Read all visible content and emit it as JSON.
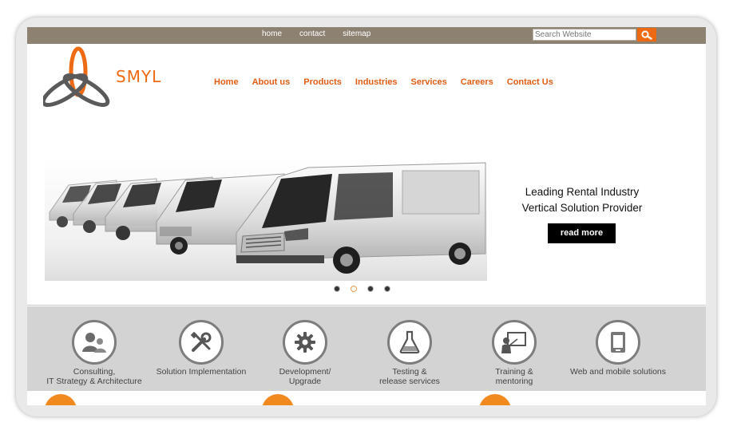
{
  "top_links": [
    "home",
    "contact",
    "sitemap"
  ],
  "search": {
    "placeholder": "Search Website"
  },
  "logo": {
    "text": "SMYL"
  },
  "nav": [
    "Home",
    "About us",
    "Products",
    "Industries",
    "Services",
    "Careers",
    "Contact Us"
  ],
  "hero": {
    "line1": "Leading Rental Industry",
    "line2": "Vertical Solution Provider",
    "button": "read more",
    "slides": 4,
    "active_slide": 2
  },
  "services": [
    {
      "line1": "Consulting,",
      "line2": "IT Strategy & Architecture",
      "icon": "consulting-people-icon"
    },
    {
      "line1": "Solution Implementation",
      "line2": "",
      "icon": "tools-icon"
    },
    {
      "line1": "Development/",
      "line2": "Upgrade",
      "icon": "gear-icon"
    },
    {
      "line1": "Testing &",
      "line2": "release services",
      "icon": "flask-icon"
    },
    {
      "line1": "Training &",
      "line2": "mentoring",
      "icon": "presentation-board-icon"
    },
    {
      "line1": "Web and mobile solutions",
      "line2": "",
      "icon": "mobile-device-icon"
    }
  ],
  "colors": {
    "brand_orange": "#ee6a12",
    "topbar": "#8d8272",
    "services_band": "#d3d3d3"
  }
}
